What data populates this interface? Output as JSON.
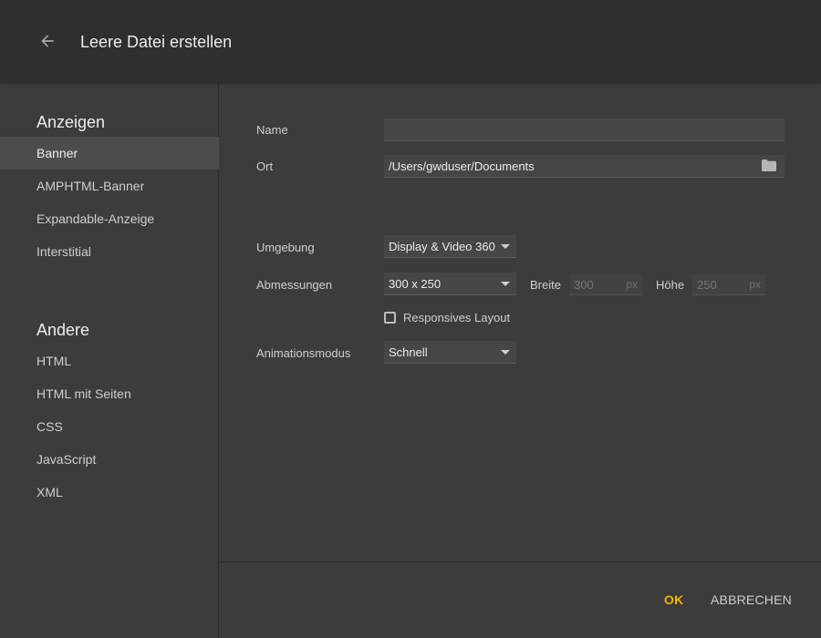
{
  "header": {
    "title": "Leere Datei erstellen",
    "back_icon": "arrow-left-icon"
  },
  "sidebar": {
    "sections": [
      {
        "title": "Anzeigen",
        "items": [
          {
            "label": "Banner",
            "selected": true
          },
          {
            "label": "AMPHTML-Banner",
            "selected": false
          },
          {
            "label": "Expandable-Anzeige",
            "selected": false
          },
          {
            "label": "Interstitial",
            "selected": false
          }
        ]
      },
      {
        "title": "Andere",
        "items": [
          {
            "label": "HTML",
            "selected": false
          },
          {
            "label": "HTML mit Seiten",
            "selected": false
          },
          {
            "label": "CSS",
            "selected": false
          },
          {
            "label": "JavaScript",
            "selected": false
          },
          {
            "label": "XML",
            "selected": false
          }
        ]
      }
    ]
  },
  "form": {
    "name": {
      "label": "Name",
      "value": ""
    },
    "location": {
      "label": "Ort",
      "value": "/Users/gwduser/Documents",
      "icon": "folder-icon"
    },
    "environment": {
      "label": "Umgebung",
      "selected": "Display & Video 360"
    },
    "dimensions": {
      "label": "Abmessungen",
      "selected": "300 x 250",
      "width_label": "Breite",
      "width_value": "300",
      "height_label": "Höhe",
      "height_value": "250",
      "unit": "px"
    },
    "responsive": {
      "label": "Responsives Layout",
      "checked": false
    },
    "animation": {
      "label": "Animationsmodus",
      "selected": "Schnell"
    }
  },
  "footer": {
    "ok_label": "OK",
    "cancel_label": "ABBRECHEN"
  },
  "colors": {
    "accent": "#f4b400",
    "header_bg": "#2f2f2f",
    "panel_bg": "#3c3c3c",
    "selected_bg": "#4c4c4c"
  }
}
